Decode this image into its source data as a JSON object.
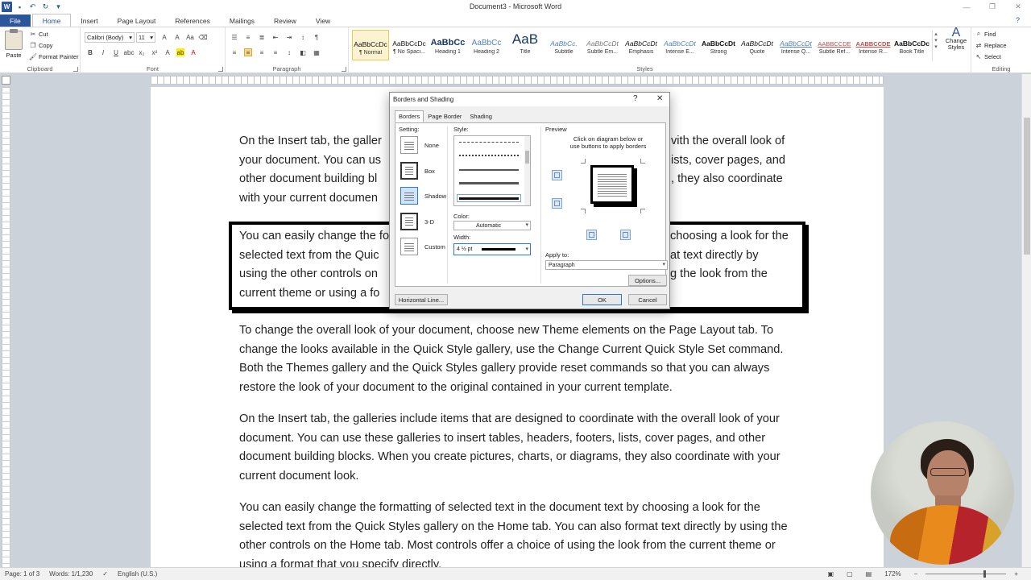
{
  "window": {
    "title": "Document3 - Microsoft Word"
  },
  "tabs": [
    "File",
    "Home",
    "Insert",
    "Page Layout",
    "References",
    "Mailings",
    "Review",
    "View"
  ],
  "ribbon": {
    "clipboard": {
      "paste": "Paste",
      "cut": "Cut",
      "copy": "Copy",
      "format_painter": "Format Painter",
      "label": "Clipboard"
    },
    "font": {
      "name": "Calibri (Body)",
      "size": "11",
      "label": "Font"
    },
    "paragraph": {
      "label": "Paragraph"
    },
    "styles": {
      "label": "Styles",
      "items": [
        {
          "sample": "AaBbCcDc",
          "name": "¶ Normal"
        },
        {
          "sample": "AaBbCcDc",
          "name": "¶ No Spaci..."
        },
        {
          "sample": "AaBbCc",
          "name": "Heading 1"
        },
        {
          "sample": "AaBbCc",
          "name": "Heading 2"
        },
        {
          "sample": "AaB",
          "name": "Title"
        },
        {
          "sample": "AaBbCc.",
          "name": "Subtitle"
        },
        {
          "sample": "AaBbCcDt",
          "name": "Subtle Em..."
        },
        {
          "sample": "AaBbCcDt",
          "name": "Emphasis"
        },
        {
          "sample": "AaBbCcDt",
          "name": "Intense E..."
        },
        {
          "sample": "AaBbCcDt",
          "name": "Strong"
        },
        {
          "sample": "AaBbCcDt",
          "name": "Quote"
        },
        {
          "sample": "AaBbCcDt",
          "name": "Intense Q..."
        },
        {
          "sample": "AABBCCDE",
          "name": "Subtle Ref..."
        },
        {
          "sample": "AABBCCDE",
          "name": "Intense R..."
        },
        {
          "sample": "AaBbCcDc",
          "name": "Book Title"
        }
      ],
      "change_styles": "Change Styles"
    },
    "editing": {
      "label": "Editing",
      "find": "Find",
      "replace": "Replace",
      "select": "Select"
    }
  },
  "document": {
    "p1": "On the Insert tab, the galleries include items that are designed to coordinate with the overall look of your document. You can use these galleries to insert tables, headers, footers, lists, cover pages, and other document building blocks. When you create pictures, charts, or diagrams, they also coordinate with your current document look.",
    "p1_left_lines": [
      "On the Insert tab, the galler",
      "your document. You can us",
      "other document building bl",
      "with your current documen"
    ],
    "p1_right_lines": [
      "vith the overall look of",
      "ists, cover pages, and",
      ", they also coordinate",
      ""
    ],
    "p2_left_lines": [
      "You can easily change the fo",
      "selected text from the Quic",
      "using the other controls on",
      "current theme or using a fo"
    ],
    "p2_right_lines": [
      "choosing a look for the",
      "at text directly by",
      "g the look from the",
      ""
    ],
    "p3": "To change the overall look of your document, choose new Theme elements on the Page Layout tab. To change the looks available in the Quick Style gallery, use the Change Current Quick Style Set command. Both the Themes gallery and the Quick Styles gallery provide reset commands so that you can always restore the look of your document to the original contained in your current template.",
    "p4": "On the Insert tab, the galleries include items that are designed to coordinate with the overall look of your document. You can use these galleries to insert tables, headers, footers, lists, cover pages, and other document building blocks. When you create pictures, charts, or diagrams, they also coordinate with your current document look.",
    "p5": "You can easily change the formatting of selected text in the document text by choosing a look for the selected text from the Quick Styles gallery on the Home tab. You can also format text directly by using the other controls on the Home tab. Most controls offer a choice of using the look from the current theme or using a format that you specify directly."
  },
  "dialog": {
    "title": "Borders and Shading",
    "help": "?",
    "close": "✕",
    "tabs": [
      "Borders",
      "Page Border",
      "Shading"
    ],
    "setting_label": "Setting:",
    "settings": [
      "None",
      "Box",
      "Shadow",
      "3-D",
      "Custom"
    ],
    "style_label": "Style:",
    "color_label": "Color:",
    "color_value": "Automatic",
    "width_label": "Width:",
    "width_value": "4 ½ pt",
    "preview_label": "Preview",
    "preview_hint": "Click on diagram below or use buttons to apply borders",
    "apply_to_label": "Apply to:",
    "apply_to_value": "Paragraph",
    "options_button": "Options...",
    "horizontal_line_button": "Horizontal Line...",
    "ok_button": "OK",
    "cancel_button": "Cancel"
  },
  "status": {
    "page": "Page: 1 of 3",
    "words": "Words: 1/1,230",
    "language": "English (U.S.)",
    "zoom": "172%"
  }
}
